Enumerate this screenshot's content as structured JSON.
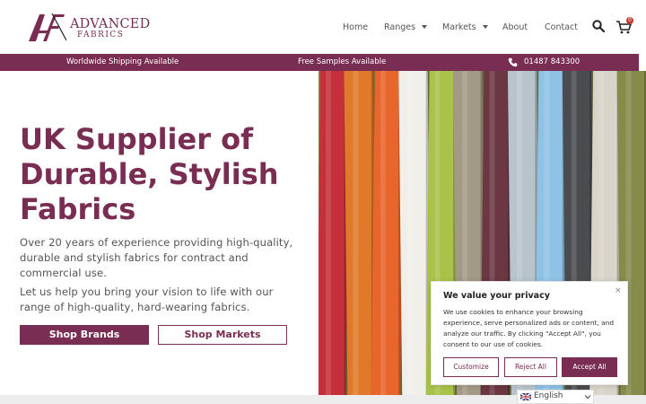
{
  "brand": {
    "logo_text_1": "ADVANCED",
    "logo_text_2": "FABRICS",
    "color_primary": "#7a2d52"
  },
  "nav": {
    "home": "Home",
    "ranges": "Ranges",
    "markets": "Markets",
    "about": "About",
    "contact": "Contact",
    "cart_count": "0",
    "icons": [
      "search-icon",
      "cart-icon",
      "chevron-down-icon"
    ]
  },
  "infobar": {
    "shipping": "Worldwide Shipping Available",
    "samples": "Free Samples Available",
    "phone": "01487 843300"
  },
  "hero": {
    "title": "UK Supplier of Durable, Stylish Fabrics",
    "paragraph_1": "Over 20 years of experience providing high-quality, durable and stylish fabrics for contract and commercial use.",
    "paragraph_2": "Let us help you bring your vision to life with our range of high-quality, hard-wearing fabrics.",
    "button_brands": "Shop Brands",
    "button_markets": "Shop Markets",
    "image_swatch_colors": [
      "#c4313c",
      "#e07a2a",
      "#e8652b",
      "#f1efe9",
      "#a9c34a",
      "#a39a85",
      "#6a3742",
      "#b8c4cc",
      "#8fc3e6",
      "#4a4c4f",
      "#d9d4c9",
      "#858c4a"
    ]
  },
  "cookie": {
    "title": "We value your privacy",
    "close": "×",
    "text": "We use cookies to enhance your browsing experience, serve personalized ads or content, and analyze our traffic. By clicking \"Accept All\", you consent to our use of cookies.",
    "customize": "Customize",
    "reject": "Reject All",
    "accept": "Accept All"
  },
  "language": {
    "selected": "English"
  }
}
